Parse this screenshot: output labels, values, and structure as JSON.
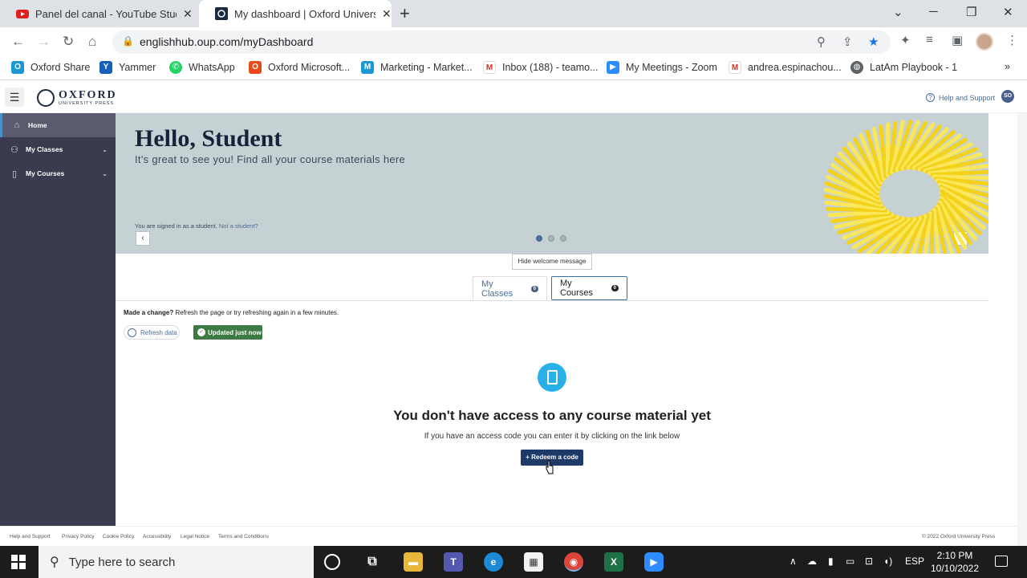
{
  "browser": {
    "tabs": [
      {
        "label": "Panel del canal - YouTube Studio",
        "active": false
      },
      {
        "label": "My dashboard | Oxford University Press",
        "active": true
      }
    ],
    "url": "englishhub.oup.com/myDashboard",
    "bookmarks": [
      "Oxford Share",
      "Yammer",
      "WhatsApp",
      "Oxford Microsoft...",
      "Marketing - Market...",
      "Inbox (188) - teamo...",
      "My Meetings - Zoom",
      "andrea.espinachou...",
      "LatAm Playbook - 1"
    ],
    "overflow_icon": "»"
  },
  "header": {
    "logo_main": "OXFORD",
    "logo_sub": "UNIVERSITY PRESS",
    "help_label": "Help and Support",
    "avatar_initials": "SO"
  },
  "sidebar": {
    "items": [
      {
        "label": "Home",
        "icon": "home-icon"
      },
      {
        "label": "My Classes",
        "icon": "people-icon"
      },
      {
        "label": "My Courses",
        "icon": "book-icon"
      }
    ]
  },
  "hero": {
    "title": "Hello, Student",
    "subtitle": "It's great to see you! Find all your course materials here",
    "signed_in_text": "You are signed in as a student.",
    "not_student_link": "Not a student?",
    "active_slide": 1,
    "slide_count": 3,
    "hide_button": "Hide welcome message"
  },
  "tabs": [
    {
      "label": "My Classes",
      "count": "0"
    },
    {
      "label": "My Courses",
      "count": "0"
    }
  ],
  "status": {
    "made_change_bold": "Made a change?",
    "made_change_text": "Refresh the page or try refreshing again in a few minutes.",
    "refresh_label": "Refresh data",
    "updated_label": "Updated just now"
  },
  "empty": {
    "title": "You don't have access to any course material yet",
    "subtitle": "If you have an access code you can enter it by clicking on the link below",
    "redeem_label": "+ Redeem a code"
  },
  "footer": {
    "links": [
      "Help and Support",
      "Privacy Policy",
      "Cookie Policy",
      "Accessibility",
      "Legal Notice",
      "Terms and Conditions"
    ],
    "copyright": "© 2022 Oxford University Press"
  },
  "taskbar": {
    "search_placeholder": "Type here to search",
    "language": "ESP",
    "time": "2:10 PM",
    "date": "10/10/2022"
  },
  "colors": {
    "sidebar_bg": "#3b3b4f",
    "hero_bg": "#c6d1d4",
    "accent": "#4a6e9b",
    "redeem_bg": "#1e3a68",
    "updated_bg": "#3e7a44"
  }
}
